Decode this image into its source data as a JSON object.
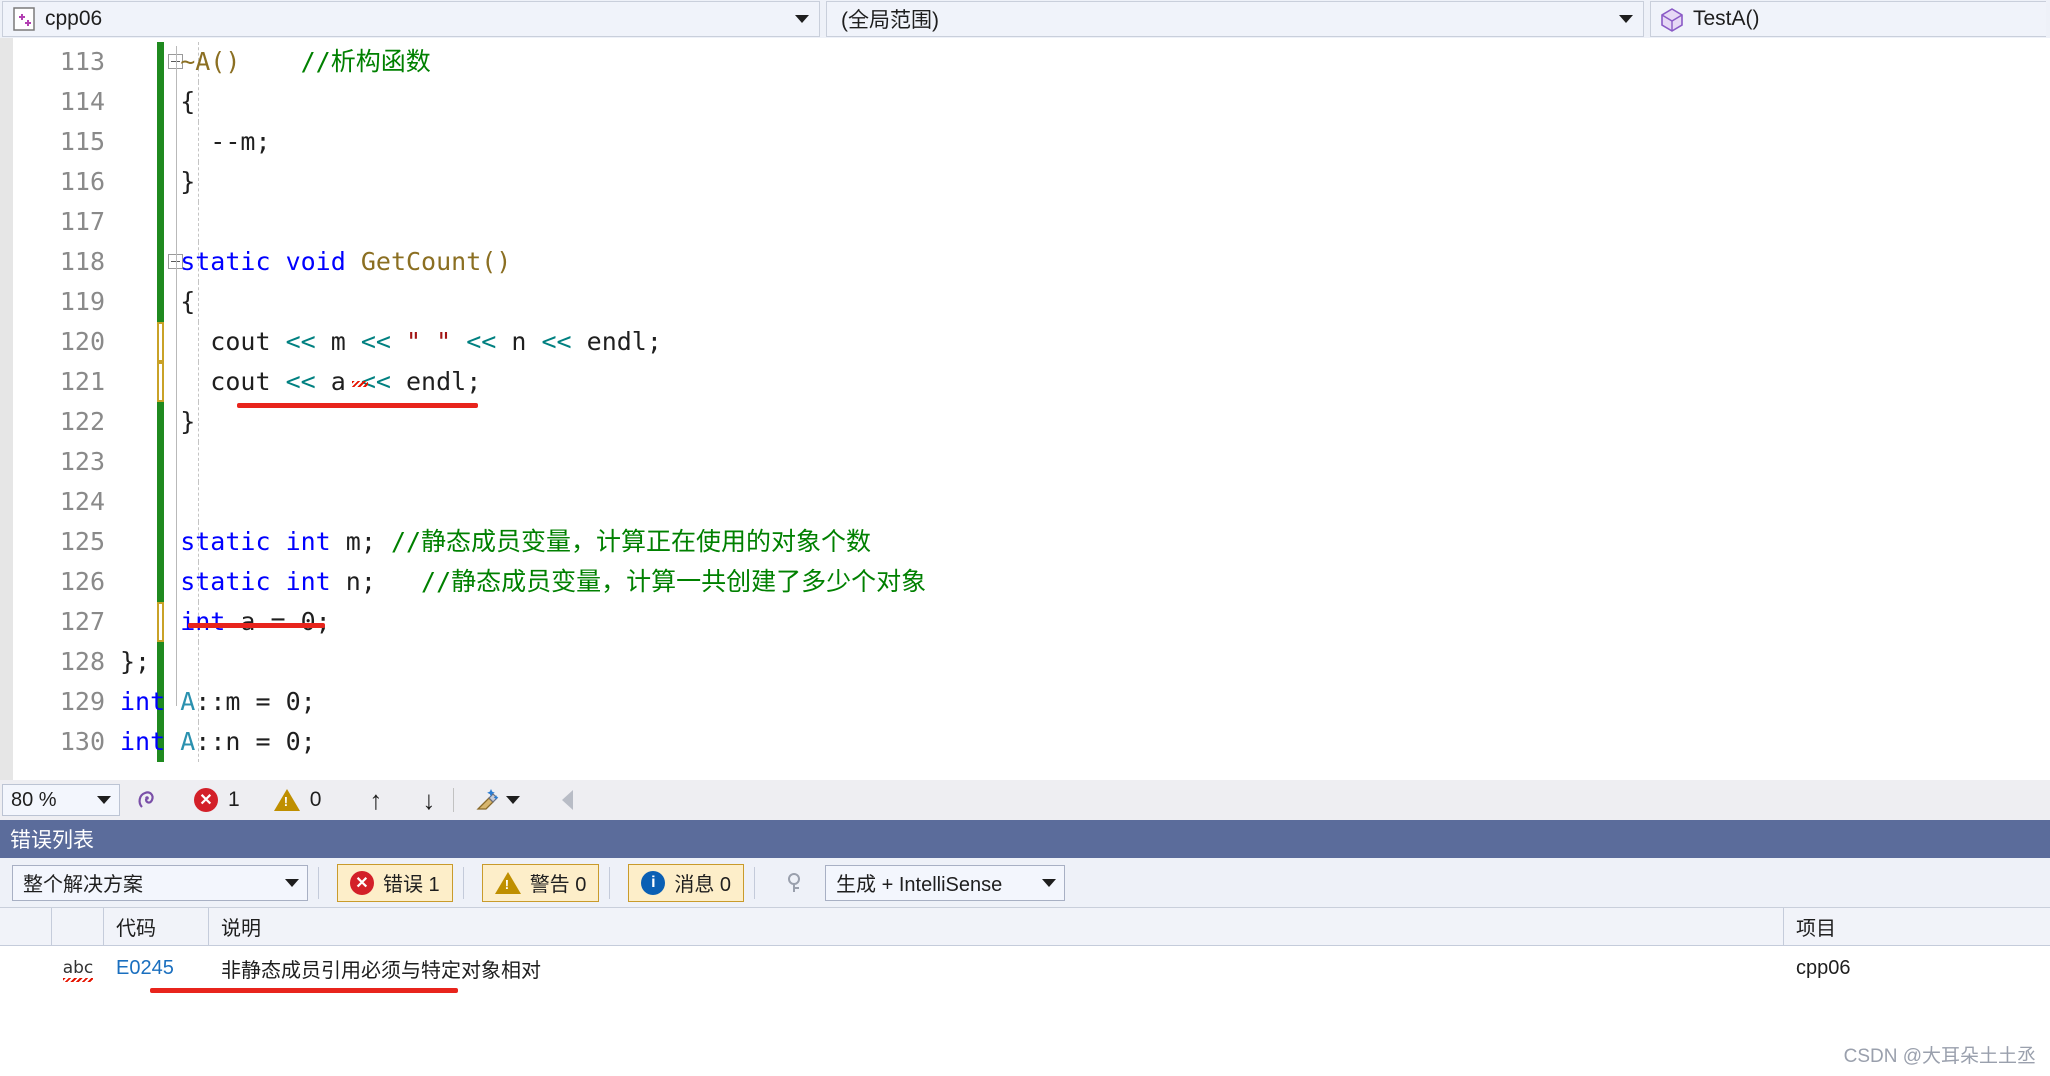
{
  "navbar": {
    "project": {
      "label": "cpp06",
      "icon": "cpp-file-icon"
    },
    "scope": {
      "label": "(全局范围)"
    },
    "member": {
      "label": "TestA()",
      "icon": "method-cube-icon"
    }
  },
  "editor": {
    "lines": [
      {
        "no": "113",
        "change": "green",
        "collapse": true,
        "indent": 2,
        "tokens": [
          {
            "t": "~A()",
            "c": "fn"
          },
          {
            "t": "    ",
            "c": "pun"
          },
          {
            "t": "//析构函数",
            "c": "cmt"
          }
        ]
      },
      {
        "no": "114",
        "change": "green",
        "collapse": false,
        "indent": 2,
        "tokens": [
          {
            "t": "{",
            "c": "pun"
          }
        ]
      },
      {
        "no": "115",
        "change": "green",
        "collapse": false,
        "indent": 3,
        "tokens": [
          {
            "t": "--m;",
            "c": "pun"
          }
        ]
      },
      {
        "no": "116",
        "change": "green",
        "collapse": false,
        "indent": 2,
        "tokens": [
          {
            "t": "}",
            "c": "pun"
          }
        ]
      },
      {
        "no": "117",
        "change": "green",
        "collapse": false,
        "indent": 0,
        "tokens": []
      },
      {
        "no": "118",
        "change": "green",
        "collapse": true,
        "indent": 2,
        "tokens": [
          {
            "t": "static",
            "c": "kw"
          },
          {
            "t": " ",
            "c": "pun"
          },
          {
            "t": "void",
            "c": "kw"
          },
          {
            "t": " ",
            "c": "pun"
          },
          {
            "t": "GetCount()",
            "c": "fn"
          }
        ]
      },
      {
        "no": "119",
        "change": "green",
        "collapse": false,
        "indent": 2,
        "tokens": [
          {
            "t": "{",
            "c": "pun"
          }
        ]
      },
      {
        "no": "120",
        "change": "gold",
        "collapse": false,
        "indent": 3,
        "tokens": [
          {
            "t": "cout ",
            "c": "pun"
          },
          {
            "t": "<<",
            "c": "op"
          },
          {
            "t": " m ",
            "c": "pun"
          },
          {
            "t": "<<",
            "c": "op"
          },
          {
            "t": " ",
            "c": "pun"
          },
          {
            "t": "\" \"",
            "c": "str"
          },
          {
            "t": " ",
            "c": "pun"
          },
          {
            "t": "<<",
            "c": "op"
          },
          {
            "t": " n ",
            "c": "pun"
          },
          {
            "t": "<<",
            "c": "op"
          },
          {
            "t": " endl;",
            "c": "pun"
          }
        ]
      },
      {
        "no": "121",
        "change": "gold",
        "collapse": false,
        "indent": 3,
        "tokens": [
          {
            "t": "cout ",
            "c": "pun"
          },
          {
            "t": "<<",
            "c": "op"
          },
          {
            "t": " a ",
            "c": "pun"
          },
          {
            "t": "<<",
            "c": "op"
          },
          {
            "t": " endl;",
            "c": "pun"
          }
        ]
      },
      {
        "no": "122",
        "change": "green",
        "collapse": false,
        "indent": 2,
        "tokens": [
          {
            "t": "}",
            "c": "pun"
          }
        ]
      },
      {
        "no": "123",
        "change": "green",
        "collapse": false,
        "indent": 0,
        "tokens": []
      },
      {
        "no": "124",
        "change": "green",
        "collapse": false,
        "indent": 0,
        "tokens": []
      },
      {
        "no": "125",
        "change": "green",
        "collapse": false,
        "indent": 2,
        "tokens": [
          {
            "t": "static",
            "c": "kw"
          },
          {
            "t": " ",
            "c": "pun"
          },
          {
            "t": "int",
            "c": "kw"
          },
          {
            "t": " m; ",
            "c": "pun"
          },
          {
            "t": "//静态成员变量，计算正在使用的对象个数",
            "c": "cmt"
          }
        ]
      },
      {
        "no": "126",
        "change": "green",
        "collapse": false,
        "indent": 2,
        "tokens": [
          {
            "t": "static",
            "c": "kw"
          },
          {
            "t": " ",
            "c": "pun"
          },
          {
            "t": "int",
            "c": "kw"
          },
          {
            "t": " n;   ",
            "c": "pun"
          },
          {
            "t": "//静态成员变量，计算一共创建了多少个对象",
            "c": "cmt"
          }
        ]
      },
      {
        "no": "127",
        "change": "gold",
        "collapse": false,
        "indent": 2,
        "tokens": [
          {
            "t": "int",
            "c": "kw"
          },
          {
            "t": " a = 0;",
            "c": "pun"
          }
        ]
      },
      {
        "no": "128",
        "change": "green",
        "collapse": false,
        "indent": 0,
        "tokens": [
          {
            "t": "};",
            "c": "pun"
          }
        ]
      },
      {
        "no": "129",
        "change": "green",
        "collapse": false,
        "indent": 0,
        "tokens": [
          {
            "t": "int",
            "c": "kw"
          },
          {
            "t": " ",
            "c": "pun"
          },
          {
            "t": "A",
            "c": "typ"
          },
          {
            "t": "::m = 0;",
            "c": "pun"
          }
        ]
      },
      {
        "no": "130",
        "change": "green",
        "collapse": false,
        "indent": 0,
        "tokens": [
          {
            "t": "int",
            "c": "kw"
          },
          {
            "t": " ",
            "c": "pun"
          },
          {
            "t": "A",
            "c": "typ"
          },
          {
            "t": "::n = 0;",
            "c": "pun"
          }
        ]
      }
    ]
  },
  "statusbar": {
    "zoom": "80 %",
    "errors": "1",
    "warnings": "0",
    "prev_label": "↑",
    "next_label": "↓"
  },
  "error_panel": {
    "title": "错误列表",
    "filter": "整个解决方案",
    "toggles": [
      {
        "name": "errors",
        "label": "错误 1",
        "icon": "error-icon"
      },
      {
        "name": "warnings",
        "label": "警告 0",
        "icon": "warning-icon"
      },
      {
        "name": "messages",
        "label": "消息 0",
        "icon": "info-icon"
      }
    ],
    "build_filter": "生成 + IntelliSense",
    "columns": [
      "",
      "",
      "代码",
      "说明",
      "项目"
    ],
    "rows": [
      {
        "icon": "abc-squiggle-icon",
        "code": "E0245",
        "description": "非静态成员引用必须与特定对象相对",
        "project": "cpp06"
      }
    ]
  },
  "watermark": "CSDN @大耳朵土土丞"
}
